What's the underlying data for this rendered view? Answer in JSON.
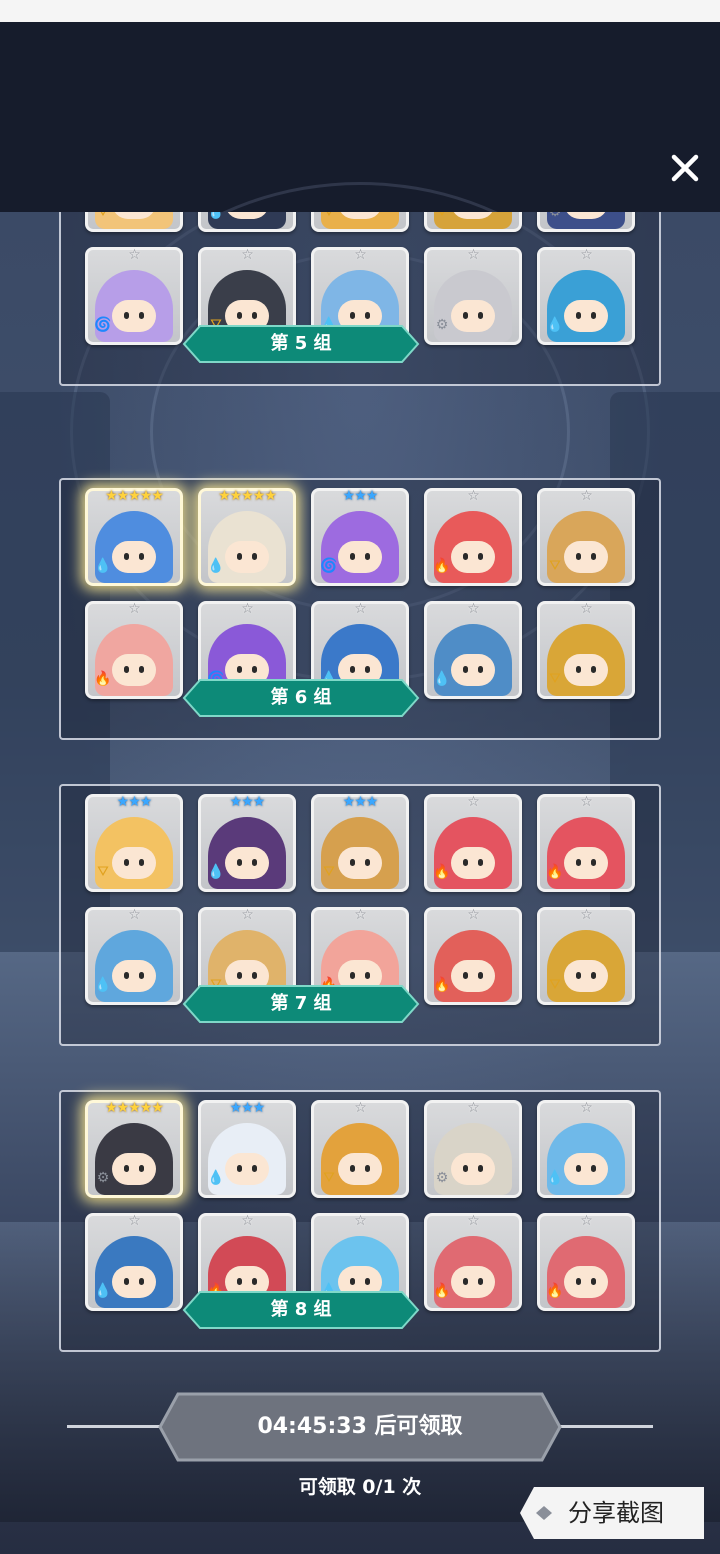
{
  "groups": [
    {
      "label": "第 5 组",
      "cards": [
        {
          "rank": "☆",
          "tier": "grey",
          "element": "earth",
          "color": "#f2c479"
        },
        {
          "rank": "☆",
          "tier": "grey",
          "element": "water",
          "color": "#2f3a55"
        },
        {
          "rank": "☆",
          "tier": "grey",
          "element": "earth",
          "color": "#e9b04a"
        },
        {
          "rank": "☆",
          "tier": "grey",
          "element": "earth",
          "color": "#d6a33a"
        },
        {
          "rank": "☆",
          "tier": "grey",
          "element": "light",
          "color": "#3d4f8a"
        },
        {
          "rank": "☆",
          "tier": "grey",
          "element": "dark",
          "color": "#b79ee8"
        },
        {
          "rank": "☆",
          "tier": "grey",
          "element": "earth",
          "color": "#3a3e4a"
        },
        {
          "rank": "☆",
          "tier": "grey",
          "element": "water",
          "color": "#7fb6e6"
        },
        {
          "rank": "☆",
          "tier": "grey",
          "element": "light",
          "color": "#c9c9cf"
        },
        {
          "rank": "☆",
          "tier": "grey",
          "element": "water",
          "color": "#3aa0d6"
        }
      ]
    },
    {
      "label": "第 6 组",
      "cards": [
        {
          "rank": "★★★★★",
          "tier": "gold",
          "element": "water",
          "color": "#4f8ddf",
          "glow": true
        },
        {
          "rank": "★★★★★",
          "tier": "gold",
          "element": "water",
          "color": "#eae2d2",
          "glow": true
        },
        {
          "rank": "★★★",
          "tier": "blue",
          "element": "dark",
          "color": "#9d6be0"
        },
        {
          "rank": "☆",
          "tier": "grey",
          "element": "fire",
          "color": "#e85a5a"
        },
        {
          "rank": "☆",
          "tier": "grey",
          "element": "earth",
          "color": "#d9a65a"
        },
        {
          "rank": "☆",
          "tier": "grey",
          "element": "fire",
          "color": "#f0a6a0"
        },
        {
          "rank": "☆",
          "tier": "grey",
          "element": "dark",
          "color": "#8a59d8"
        },
        {
          "rank": "☆",
          "tier": "grey",
          "element": "water",
          "color": "#3b79c9"
        },
        {
          "rank": "☆",
          "tier": "grey",
          "element": "water",
          "color": "#4f8dc7"
        },
        {
          "rank": "☆",
          "tier": "grey",
          "element": "earth",
          "color": "#d9a637"
        }
      ]
    },
    {
      "label": "第 7 组",
      "cards": [
        {
          "rank": "★★★",
          "tier": "blue",
          "element": "earth",
          "color": "#f3c262"
        },
        {
          "rank": "★★★",
          "tier": "blue",
          "element": "water",
          "color": "#5a3a7a"
        },
        {
          "rank": "★★★",
          "tier": "blue",
          "element": "earth",
          "color": "#d6a04e"
        },
        {
          "rank": "☆",
          "tier": "grey",
          "element": "fire",
          "color": "#e45460"
        },
        {
          "rank": "☆",
          "tier": "grey",
          "element": "fire",
          "color": "#e45460"
        },
        {
          "rank": "☆",
          "tier": "grey",
          "element": "water",
          "color": "#5fa7dd"
        },
        {
          "rank": "☆",
          "tier": "grey",
          "element": "earth",
          "color": "#e0b36a"
        },
        {
          "rank": "☆",
          "tier": "grey",
          "element": "fire",
          "color": "#f2a49a"
        },
        {
          "rank": "☆",
          "tier": "grey",
          "element": "fire",
          "color": "#e2605a"
        },
        {
          "rank": "☆",
          "tier": "grey",
          "element": "earth",
          "color": "#d9a637"
        }
      ]
    },
    {
      "label": "第 8 组",
      "cards": [
        {
          "rank": "★★★★★",
          "tier": "gold",
          "element": "light",
          "color": "#3a3a44",
          "glow": true
        },
        {
          "rank": "★★★",
          "tier": "blue",
          "element": "water",
          "color": "#e8eef6"
        },
        {
          "rank": "☆",
          "tier": "grey",
          "element": "earth",
          "color": "#e3a23c"
        },
        {
          "rank": "☆",
          "tier": "grey",
          "element": "light",
          "color": "#d9d4c8"
        },
        {
          "rank": "☆",
          "tier": "grey",
          "element": "water",
          "color": "#6fb9e9"
        },
        {
          "rank": "☆",
          "tier": "grey",
          "element": "water",
          "color": "#3a79c0"
        },
        {
          "rank": "☆",
          "tier": "grey",
          "element": "fire",
          "color": "#d24a56"
        },
        {
          "rank": "☆",
          "tier": "grey",
          "element": "water",
          "color": "#6cc3ee"
        },
        {
          "rank": "☆",
          "tier": "grey",
          "element": "fire",
          "color": "#e06a72"
        },
        {
          "rank": "☆",
          "tier": "grey",
          "element": "fire",
          "color": "#e06a72"
        }
      ]
    }
  ],
  "element_icons": {
    "water": "💧",
    "fire": "🔥",
    "earth": "⛛",
    "light": "⚙",
    "dark": "🌀"
  },
  "element_colors": {
    "water": "#2f8fe0",
    "fire": "#e2452f",
    "earth": "#e0a21f",
    "light": "#8a8f99",
    "dark": "#b23fd6"
  },
  "timer_text": "04:45:33 后可领取",
  "claim_text": "可领取 0/1 次",
  "share_label": "分享截图",
  "close_icon": "×",
  "colors": {
    "banner": "#0d8a78",
    "banner_edge": "#7fd8c8",
    "timer_fill": "#6e737e"
  }
}
